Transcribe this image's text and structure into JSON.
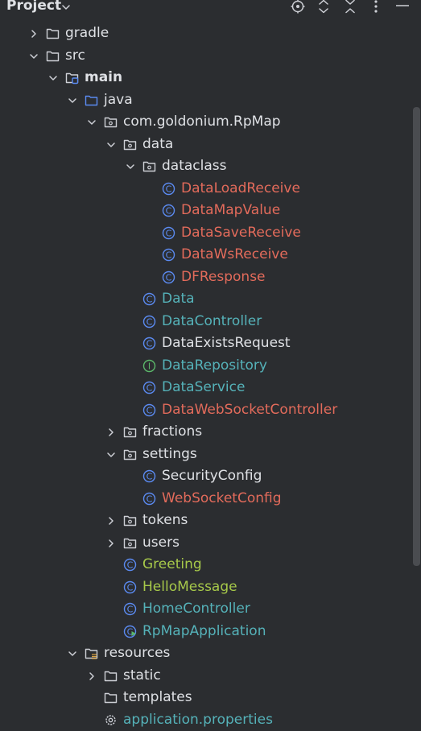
{
  "header": {
    "title": "Project",
    "icons": [
      "chevron-down-icon",
      "locate-icon",
      "expand-all-icon",
      "collapse-all-icon",
      "more-icon",
      "minimize-icon"
    ]
  },
  "colors": {
    "background": "#2b2d30",
    "text": "#dfe1e5",
    "teal": "#55b2b9",
    "red": "#e36b5b",
    "lime": "#a7c94a",
    "class_icon": "#5b8bf2",
    "interface_icon": "#5bb76a",
    "folder_icon": "#ced0d6",
    "java_folder_icon": "#5b8bf2"
  },
  "tree": [
    {
      "level": 1,
      "arrow": "right",
      "icon": "folder",
      "label": "gradle",
      "color": "plain"
    },
    {
      "level": 1,
      "arrow": "down",
      "icon": "folder",
      "label": "src",
      "color": "plain"
    },
    {
      "level": 2,
      "arrow": "down",
      "icon": "module-folder",
      "label": "main",
      "color": "plain",
      "bold": true
    },
    {
      "level": 3,
      "arrow": "down",
      "icon": "source-folder",
      "label": "java",
      "color": "plain"
    },
    {
      "level": 4,
      "arrow": "down",
      "icon": "package",
      "label": "com.goldonium.RpMap",
      "color": "plain"
    },
    {
      "level": 5,
      "arrow": "down",
      "icon": "package",
      "label": "data",
      "color": "plain"
    },
    {
      "level": 6,
      "arrow": "down",
      "icon": "package",
      "label": "dataclass",
      "color": "plain"
    },
    {
      "level": 7,
      "arrow": "none",
      "icon": "class",
      "label": "DataLoadReceive",
      "color": "red"
    },
    {
      "level": 7,
      "arrow": "none",
      "icon": "class",
      "label": "DataMapValue",
      "color": "red"
    },
    {
      "level": 7,
      "arrow": "none",
      "icon": "class",
      "label": "DataSaveReceive",
      "color": "red"
    },
    {
      "level": 7,
      "arrow": "none",
      "icon": "class",
      "label": "DataWsReceive",
      "color": "red"
    },
    {
      "level": 7,
      "arrow": "none",
      "icon": "class",
      "label": "DFResponse",
      "color": "red"
    },
    {
      "level": 6,
      "arrow": "none",
      "icon": "class",
      "label": "Data",
      "color": "teal"
    },
    {
      "level": 6,
      "arrow": "none",
      "icon": "class",
      "label": "DataController",
      "color": "teal"
    },
    {
      "level": 6,
      "arrow": "none",
      "icon": "class",
      "label": "DataExistsRequest",
      "color": "plain"
    },
    {
      "level": 6,
      "arrow": "none",
      "icon": "interface",
      "label": "DataRepository",
      "color": "teal"
    },
    {
      "level": 6,
      "arrow": "none",
      "icon": "class",
      "label": "DataService",
      "color": "teal"
    },
    {
      "level": 6,
      "arrow": "none",
      "icon": "class",
      "label": "DataWebSocketController",
      "color": "red"
    },
    {
      "level": 5,
      "arrow": "right",
      "icon": "package",
      "label": "fractions",
      "color": "plain"
    },
    {
      "level": 5,
      "arrow": "down",
      "icon": "package",
      "label": "settings",
      "color": "plain"
    },
    {
      "level": 6,
      "arrow": "none",
      "icon": "class",
      "label": "SecurityConfig",
      "color": "plain"
    },
    {
      "level": 6,
      "arrow": "none",
      "icon": "class",
      "label": "WebSocketConfig",
      "color": "red"
    },
    {
      "level": 5,
      "arrow": "right",
      "icon": "package",
      "label": "tokens",
      "color": "plain"
    },
    {
      "level": 5,
      "arrow": "right",
      "icon": "package",
      "label": "users",
      "color": "plain"
    },
    {
      "level": 5,
      "arrow": "none",
      "icon": "class",
      "label": "Greeting",
      "color": "lime"
    },
    {
      "level": 5,
      "arrow": "none",
      "icon": "class",
      "label": "HelloMessage",
      "color": "lime"
    },
    {
      "level": 5,
      "arrow": "none",
      "icon": "class",
      "label": "HomeController",
      "color": "teal"
    },
    {
      "level": 5,
      "arrow": "none",
      "icon": "spring-class",
      "label": "RpMapApplication",
      "color": "teal"
    },
    {
      "level": 3,
      "arrow": "down",
      "icon": "resources-folder",
      "label": "resources",
      "color": "plain"
    },
    {
      "level": 4,
      "arrow": "right",
      "icon": "folder",
      "label": "static",
      "color": "plain"
    },
    {
      "level": 4,
      "arrow": "none",
      "icon": "folder",
      "label": "templates",
      "color": "plain"
    },
    {
      "level": 4,
      "arrow": "none",
      "icon": "settings-file",
      "label": "application.properties",
      "color": "teal"
    }
  ]
}
